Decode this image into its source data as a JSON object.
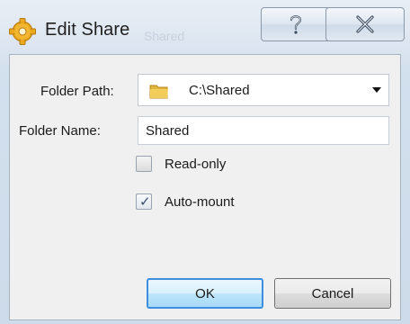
{
  "window": {
    "title": "Edit Share",
    "title_icon": "gear-icon",
    "help_icon": "help-icon",
    "close_icon": "close-icon",
    "background_text": "Shared"
  },
  "form": {
    "folder_path_label": "Folder Path:",
    "folder_path_value": "C:\\Shared",
    "folder_path_icon": "folder-icon",
    "folder_name_label": "Folder Name:",
    "folder_name_value": "Shared",
    "read_only_label": "Read-only",
    "read_only_checked": false,
    "auto_mount_label": "Auto-mount",
    "auto_mount_checked": true
  },
  "buttons": {
    "ok_label": "OK",
    "cancel_label": "Cancel"
  },
  "colors": {
    "ok_border": "#3d8ee0",
    "title_bar": "#d7e2ee"
  }
}
